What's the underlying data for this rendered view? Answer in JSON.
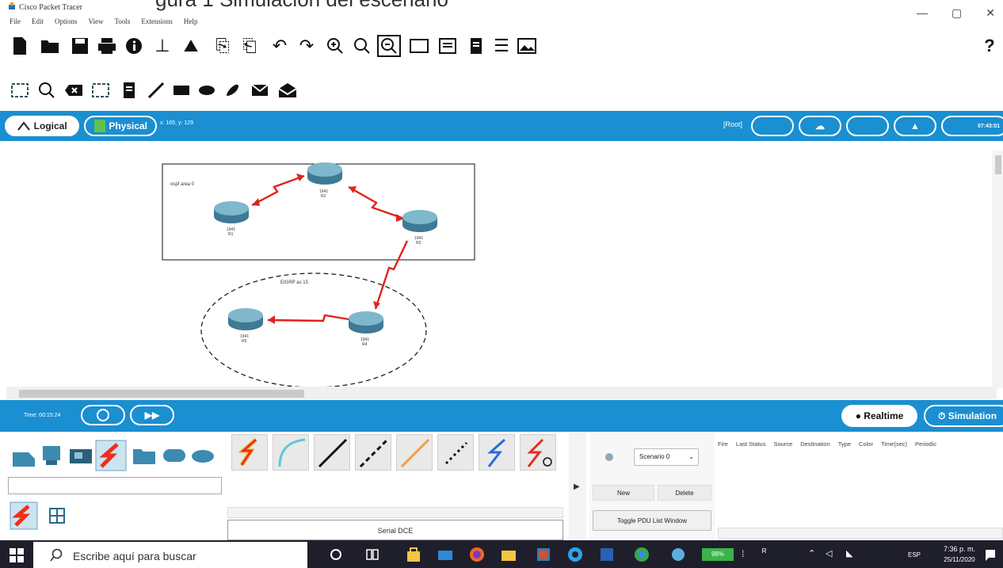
{
  "window": {
    "title": "Cisco Packet Tracer",
    "cutoff_heading": "gura 1 Simulación del escenario",
    "controls": {
      "minimize": "—",
      "maximize": "▢",
      "close": "✕"
    }
  },
  "menu": [
    "File",
    "Edit",
    "Options",
    "View",
    "Tools",
    "Extensions",
    "Help"
  ],
  "toolbar_help": "?",
  "modes": {
    "logical": "Logical",
    "physical": "Physical",
    "coords": "x: 165, y: 129",
    "root": "[Root]",
    "clock": "07:43:01"
  },
  "topology": {
    "area_label": "ospf area 0",
    "eigrp_label": "EIGRP as 15",
    "routers": [
      {
        "id": "R1",
        "model": "1941",
        "name": "R1"
      },
      {
        "id": "R2",
        "model": "1941",
        "name": "R2"
      },
      {
        "id": "R3",
        "model": "1941",
        "name": "R3"
      },
      {
        "id": "R4",
        "model": "1941",
        "name": "R4"
      },
      {
        "id": "R5",
        "model": "1941",
        "name": "R5"
      }
    ],
    "link_color": "#e0231c"
  },
  "timebar": {
    "time": "Time: 00:15:24",
    "realtime": "Realtime",
    "simulation": "Simulation"
  },
  "cables": {
    "selected_name": "Serial DCE"
  },
  "scenario": {
    "selected": "Scenario 0",
    "new": "New",
    "delete": "Delete",
    "toggle": "Toggle PDU List Window"
  },
  "pdu_columns": [
    "Fire",
    "Last Status",
    "Source",
    "Destination",
    "Type",
    "Color",
    "Time(sec)",
    "Periodic"
  ],
  "taskbar": {
    "search_placeholder": "Escribe aquí para buscar",
    "battery": "98%",
    "lang": "ESP",
    "time": "7:36 p. m.",
    "date": "25/11/2020"
  },
  "colors": {
    "accent_blue": "#1a8fd1",
    "taskbar": "#1f1f2b",
    "link_red": "#e0231c"
  }
}
